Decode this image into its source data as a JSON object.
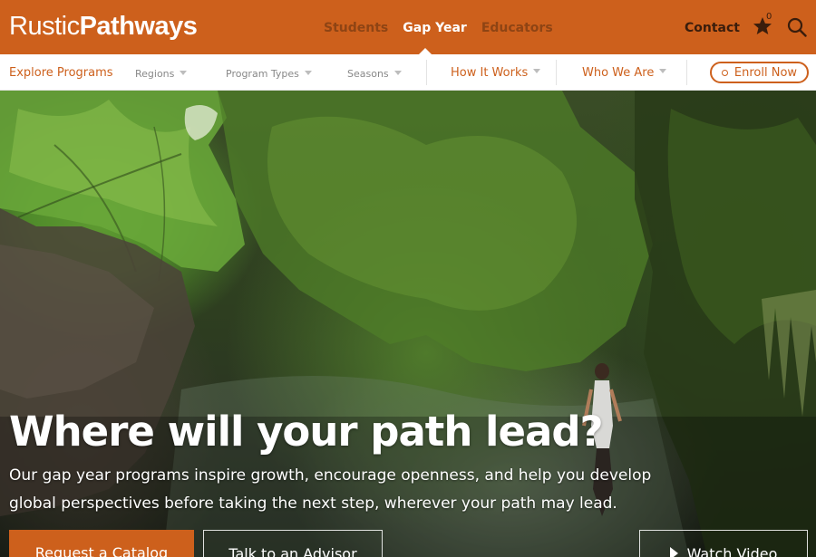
{
  "brand": {
    "logo_light": "Rustic",
    "logo_bold": "Pathways"
  },
  "audience_tabs": [
    {
      "label": "Students",
      "active": false
    },
    {
      "label": "Gap Year",
      "active": true
    },
    {
      "label": "Educators",
      "active": false
    }
  ],
  "header": {
    "contact_label": "Contact",
    "favorites_count": "0",
    "star_icon": "star-icon",
    "search_icon": "search-icon"
  },
  "subnav": {
    "explore_label": "Explore Programs",
    "filters": [
      "Regions",
      "Program Types",
      "Seasons"
    ],
    "menus": [
      "How It Works",
      "Who We Are"
    ],
    "enroll_label": "Enroll Now"
  },
  "hero": {
    "title": "Where will your path lead?",
    "subtitle": "Our gap year programs inspire growth, encourage openness, and help you develop global perspectives before taking the next step, wherever your path may lead.",
    "buttons": {
      "catalog": "Request a Catalog",
      "advisor": "Talk to an Advisor",
      "video": "Watch Video"
    }
  },
  "colors": {
    "brand_orange": "#cd601c",
    "nav_inactive": "#8e4414",
    "white": "#ffffff"
  }
}
